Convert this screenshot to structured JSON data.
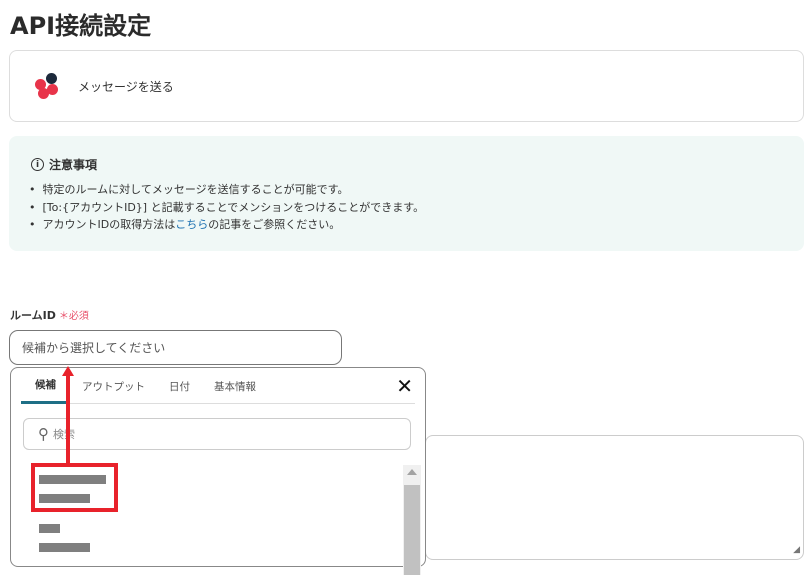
{
  "page": {
    "title": "API接続設定"
  },
  "app_card": {
    "action": "メッセージを送る"
  },
  "notice": {
    "heading": "注意事項",
    "items": [
      "特定のルームに対してメッセージを送信することが可能です。",
      "[To:{アカウントID}] と記載することでメンションをつけることができます。"
    ],
    "item3_pre": "アカウントIDの取得方法は",
    "item3_link": "こちら",
    "item3_post": "の記事をご参照ください。"
  },
  "field": {
    "label": "ルームID",
    "required": "＊必須",
    "placeholder": "候補から選択してください"
  },
  "dropdown": {
    "tabs": [
      "候補",
      "アウトプット",
      "日付",
      "基本情報"
    ],
    "search_placeholder": "検索"
  },
  "colors": {
    "accent": "#1e6f86",
    "annotation": "#e8222b",
    "required": "#e8506a"
  }
}
